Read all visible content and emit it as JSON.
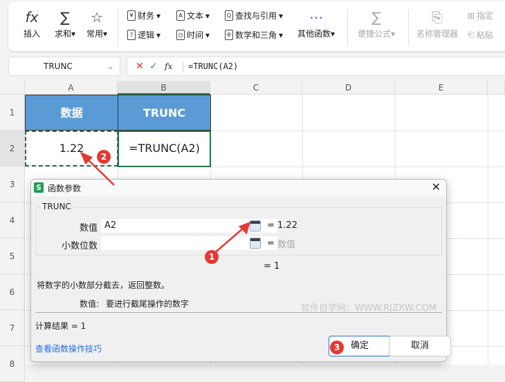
{
  "ribbon": {
    "insert": "插入",
    "sum": "求和",
    "common": "常用",
    "finance": "财务",
    "logic": "逻辑",
    "text": "文本",
    "time": "时间",
    "lookup": "查找与引用",
    "math": "数学和三角",
    "other": "其他函数",
    "quick_formula": "便捷公式",
    "name_manager": "名称管理器",
    "specify": "指定",
    "paste": "粘贴"
  },
  "name_box": "TRUNC",
  "formula": "=TRUNC(A2)",
  "columns": [
    "A",
    "B",
    "C",
    "D",
    "E"
  ],
  "rows": [
    "1",
    "2",
    "3",
    "4",
    "5",
    "6",
    "7",
    "8"
  ],
  "cells": {
    "a1": "数据",
    "b1": "TRUNC",
    "a2": "1.22",
    "b2": "=TRUNC(A2)"
  },
  "dialog": {
    "title": "函数参数",
    "app_icon": "S",
    "group": "TRUNC",
    "arg1_label": "数值",
    "arg1_value": "A2",
    "arg1_result": "= 1.22",
    "arg2_label": "小数位数",
    "arg2_value": "",
    "arg2_result_eq": "=",
    "arg2_result": "数值",
    "formula_result": "= 1",
    "description": "将数字的小数部分截去，返回整数。",
    "arg_desc_label": "数值:",
    "arg_desc": "要进行截尾操作的数字",
    "watermark": "软件自学网：WWW.RJZXW.COM",
    "calc_label": "计算结果  =  1",
    "help_link": "查看函数操作技巧",
    "ok": "确定",
    "cancel": "取消"
  },
  "annotations": [
    "1",
    "2",
    "3"
  ]
}
